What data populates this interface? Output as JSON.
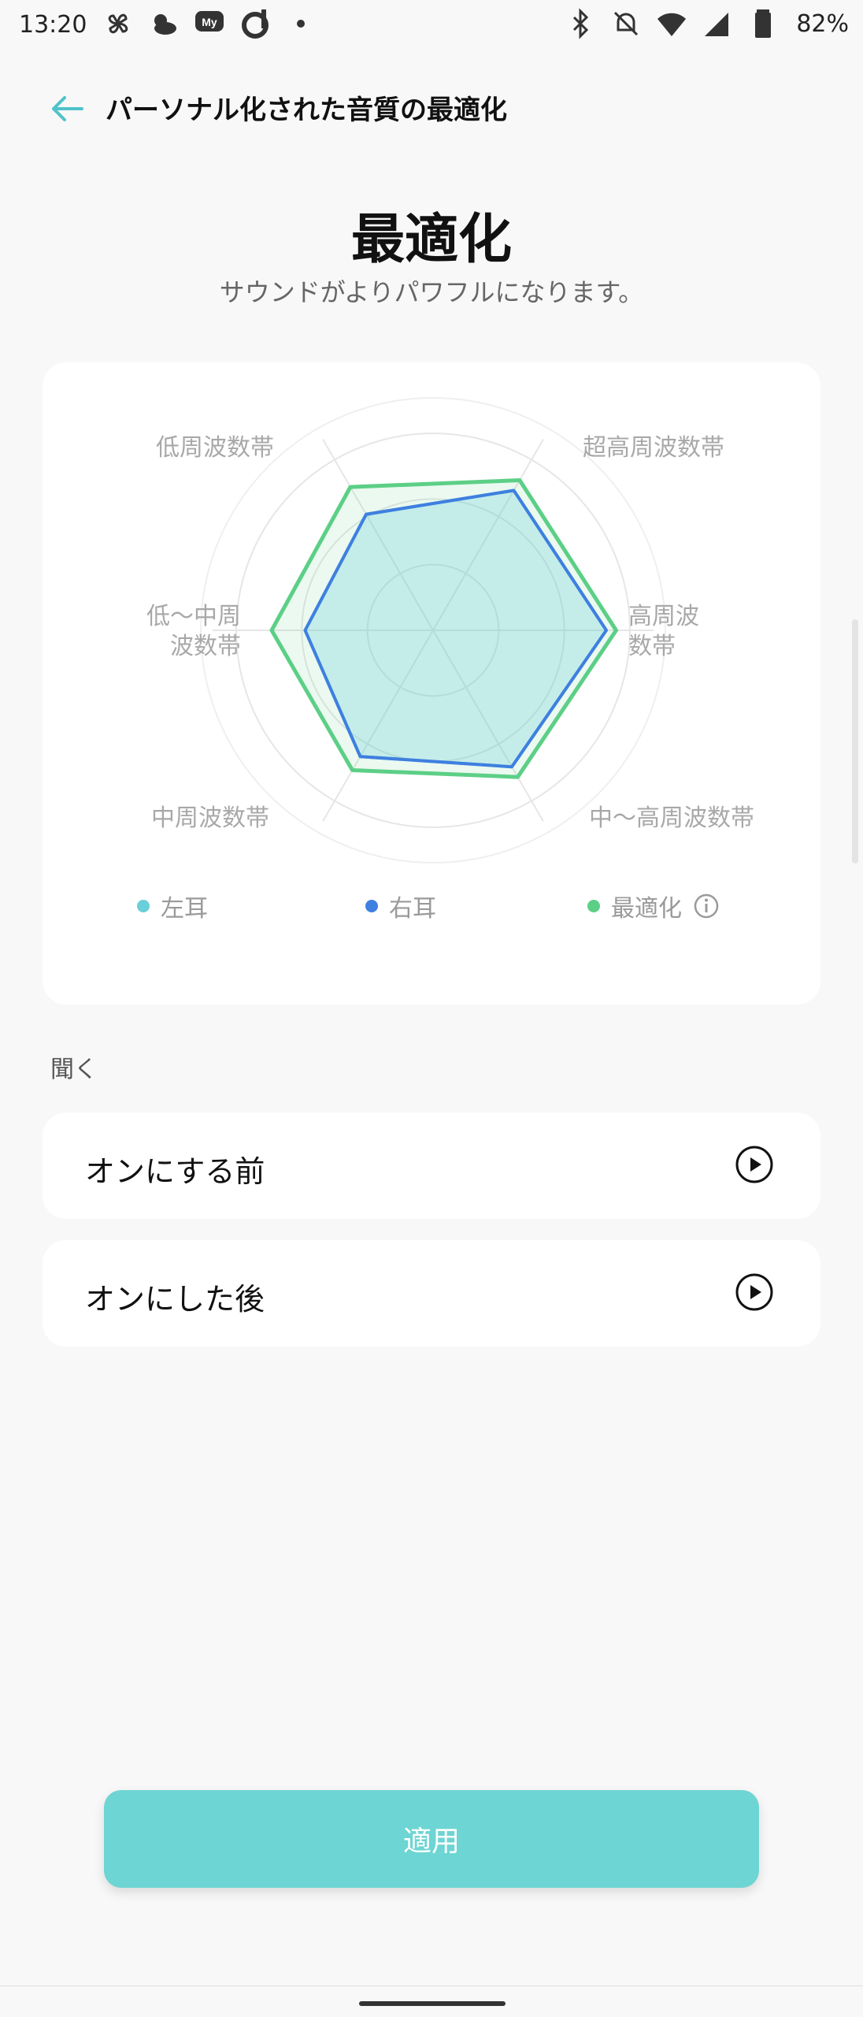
{
  "status_bar": {
    "time": "13:20",
    "battery": "82%",
    "icons_left": [
      "pinwheel-icon",
      "weather-icon",
      "my-docomo-icon",
      "d-app-icon",
      "dot-icon"
    ],
    "icons_right": [
      "bluetooth-icon",
      "mute-icon",
      "wifi-icon",
      "signal-icon",
      "battery-icon"
    ]
  },
  "header": {
    "title": "パーソナル化された音質の最適化",
    "back_icon": "arrow-left-icon",
    "accent_color": "#4fc3c9"
  },
  "hero": {
    "title": "最適化",
    "subtitle": "サウンドがよりパワフルになります。"
  },
  "chart_data": {
    "type": "radar",
    "axes": [
      "超高周波数帯",
      "高周波数帯",
      "中〜高周波数帯",
      "中周波数帯",
      "低〜中周波数帯",
      "低周波数帯"
    ],
    "series": [
      {
        "name": "左耳",
        "color": "#69cfd9",
        "values": [
          0.82,
          0.88,
          0.8,
          0.74,
          0.65,
          0.68
        ]
      },
      {
        "name": "右耳",
        "color": "#3f7fe0",
        "values": [
          0.82,
          0.88,
          0.8,
          0.74,
          0.65,
          0.68
        ]
      },
      {
        "name": "最適化",
        "color": "#5ccf86",
        "values": [
          0.88,
          0.93,
          0.86,
          0.82,
          0.82,
          0.84
        ]
      }
    ],
    "rings": 3,
    "legend": "bottom"
  },
  "legend": {
    "left_ear": "左耳",
    "right_ear": "右耳",
    "optimized": "最適化",
    "info_icon": "info-icon"
  },
  "listen": {
    "section_label": "聞く",
    "before_label": "オンにする前",
    "after_label": "オンにした後",
    "play_icon": "play-icon"
  },
  "apply_button": {
    "label": "適用",
    "color": "#6dd5d3"
  }
}
